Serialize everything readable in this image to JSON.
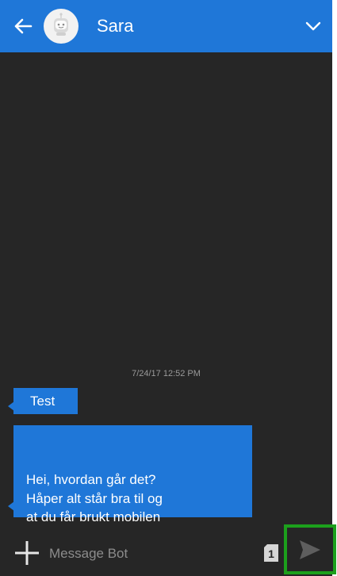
{
  "header": {
    "contact_name": "Sara",
    "back_icon": "arrow-left-icon",
    "menu_icon": "chevron-down-icon",
    "avatar_icon": "bot-avatar-icon",
    "color": "#1f77d8"
  },
  "conversation": {
    "timestamp": "7/24/17 12:52 PM",
    "messages": [
      {
        "sender": "bot",
        "text": "Test"
      },
      {
        "sender": "bot",
        "text": "Hei, hvordan går det?\nHåper alt står bra til og\nat du får brukt mobilen\nog lært masse nytt!"
      }
    ]
  },
  "composer": {
    "placeholder": "Message Bot",
    "sim_badge": "1",
    "add_icon": "plus-icon",
    "send_icon": "send-icon",
    "highlight_color": "#1ca01c"
  }
}
